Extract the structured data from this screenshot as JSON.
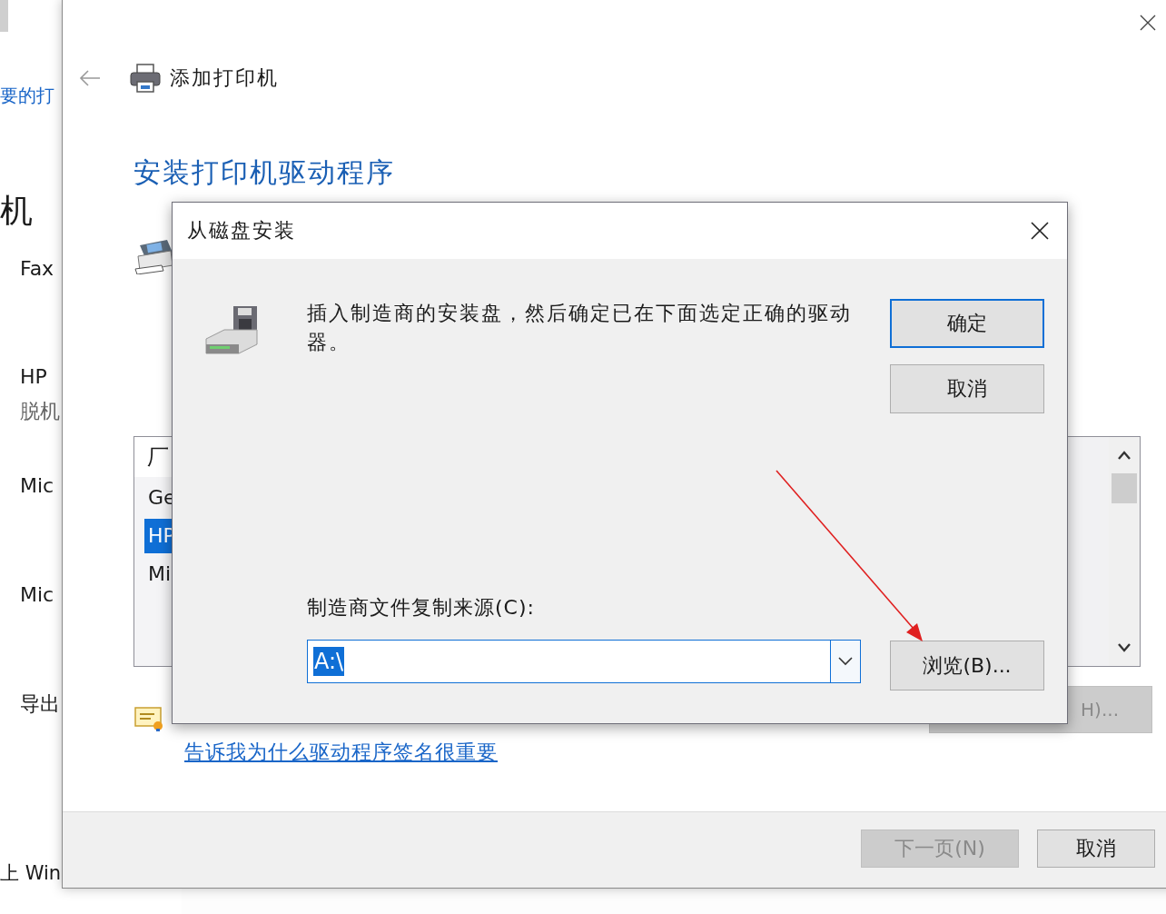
{
  "background_window": {
    "items": [
      {
        "kind": "link",
        "text": "要的打"
      },
      {
        "kind": "heading",
        "text": "机"
      },
      {
        "kind": "text",
        "text": "Fax"
      },
      {
        "kind": "text",
        "text": "HP"
      },
      {
        "kind": "subtext",
        "text": "脱机"
      },
      {
        "kind": "text",
        "text": "Mic"
      },
      {
        "kind": "text",
        "text": "Mic"
      },
      {
        "kind": "text",
        "text": "导出"
      },
      {
        "kind": "edge",
        "text": "上 Win"
      }
    ]
  },
  "wizard": {
    "title": "添加打印机",
    "heading": "安装打印机驱动程序",
    "manufacturer_list": {
      "header": "厂",
      "items": [
        {
          "text": "Ge",
          "selected": false
        },
        {
          "text": "HP",
          "selected": true
        },
        {
          "text": "Mi",
          "selected": false
        }
      ]
    },
    "disk_button": {
      "label": "H)...",
      "disabled": true
    },
    "signature_link": "告诉我为什么驱动程序签名很重要",
    "buttons": [
      {
        "label": "下一页(N)",
        "disabled": true
      },
      {
        "label": "取消",
        "disabled": false
      }
    ]
  },
  "dialog": {
    "title": "从磁盘安装",
    "message": "插入制造商的安装盘，然后确定已在下面选定正确的驱动器。",
    "buttons": [
      {
        "label": "确定",
        "default": true
      },
      {
        "label": "取消",
        "default": false
      }
    ],
    "source_label": "制造商文件复制来源(C):",
    "source": {
      "value": "A:\\",
      "highlighted": true
    },
    "browse_button": "浏览(B)..."
  }
}
